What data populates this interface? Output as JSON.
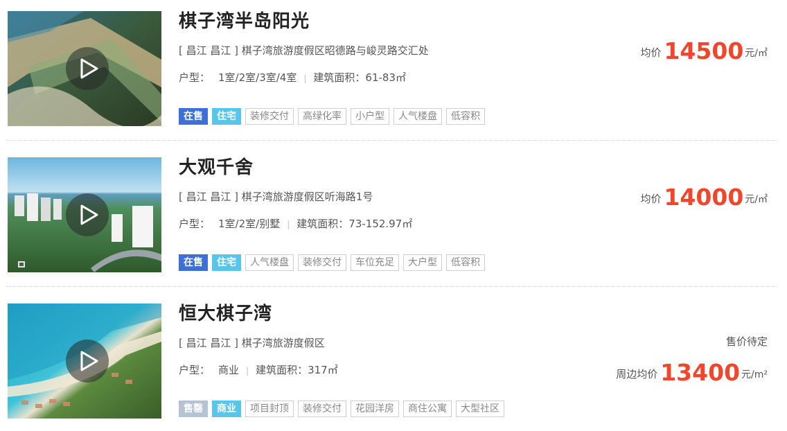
{
  "listings": [
    {
      "title": "棋子湾半岛阳光",
      "address": "[ 昌江  昌江 ] 棋子湾旅游度假区昭德路与峻灵路交汇处",
      "layout_label": "户型：",
      "layout_value": "1室/2室/3室/4室",
      "area_label": "建筑面积：",
      "area_value": "61-83㎡",
      "status_tag": "在售",
      "type_tag": "住宅",
      "tags": [
        "装修交付",
        "高绿化率",
        "小户型",
        "人气楼盘",
        "低容积"
      ],
      "price_prefix": "均价",
      "price_value": "14500",
      "price_unit": "元/㎡"
    },
    {
      "title": "大观千舍",
      "address": "[ 昌江  昌江 ] 棋子湾旅游度假区听海路1号",
      "layout_label": "户型：",
      "layout_value": "1室/2室/别墅",
      "area_label": "建筑面积：",
      "area_value": "73-152.97㎡",
      "status_tag": "在售",
      "type_tag": "住宅",
      "tags": [
        "人气楼盘",
        "装修交付",
        "车位充足",
        "大户型",
        "低容积"
      ],
      "price_prefix": "均价",
      "price_value": "14000",
      "price_unit": "元/㎡"
    },
    {
      "title": "恒大棋子湾",
      "address": "[ 昌江  昌江 ] 棋子湾旅游度假区",
      "layout_label": "户型：",
      "layout_value": "商业",
      "area_label": "建筑面积：",
      "area_value": "317㎡",
      "status_tag": "售罄",
      "type_tag": "商业",
      "tags": [
        "项目封顶",
        "装修交付",
        "花园洋房",
        "商住公寓",
        "大型社区"
      ],
      "price_pending": "售价待定",
      "price_prefix": "周边均价",
      "price_value": "13400",
      "price_unit": "元/m²"
    }
  ],
  "icons": {
    "play": "play-icon",
    "tour": "panorama-icon"
  },
  "colors": {
    "price": "#f0462b",
    "status_on_sale": "#3d6fd6",
    "status_sold_out": "#b5c3d2",
    "type_tag": "#58c6ea"
  }
}
